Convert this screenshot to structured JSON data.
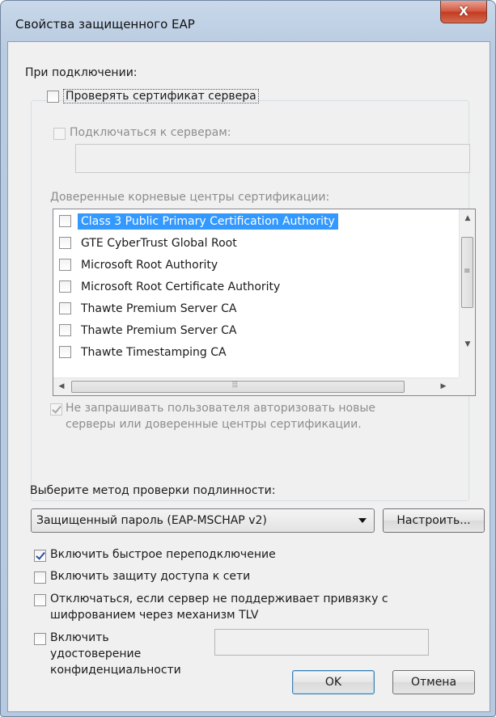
{
  "window": {
    "title": "Свойства защищенного EAP",
    "close_glyph": "X"
  },
  "on_connect": {
    "label": "При подключении:",
    "verify_cert": {
      "label": "Проверять сертификат сервера",
      "checked": false
    },
    "connect_to_servers": {
      "label": "Подключаться к серверам:",
      "checked": false,
      "value": ""
    },
    "trusted_roots_label": "Доверенные корневые центры сертификации:",
    "ca_list": [
      {
        "label": "Class 3 Public Primary Certification Authority",
        "checked": false,
        "selected": true
      },
      {
        "label": "GTE CyberTrust Global Root",
        "checked": false,
        "selected": false
      },
      {
        "label": "Microsoft Root Authority",
        "checked": false,
        "selected": false
      },
      {
        "label": "Microsoft Root Certificate Authority",
        "checked": false,
        "selected": false
      },
      {
        "label": "Thawte Premium Server CA",
        "checked": false,
        "selected": false
      },
      {
        "label": "Thawte Premium Server CA",
        "checked": false,
        "selected": false
      },
      {
        "label": "Thawte Timestamping CA",
        "checked": false,
        "selected": false
      }
    ],
    "no_prompt": {
      "line1": "Не запрашивать пользователя авторизовать новые",
      "line2": "серверы или доверенные центры сертификации.",
      "checked": true
    }
  },
  "auth_method": {
    "label": "Выберите метод проверки подлинности:",
    "selected": "Защищенный пароль (EAP-MSCHAP v2)",
    "configure_button": "Настроить..."
  },
  "options": {
    "fast_reconnect": {
      "label": "Включить быстрое переподключение",
      "checked": true
    },
    "nap": {
      "label": "Включить защиту доступа к сети",
      "checked": false
    },
    "disconnect_tlv": {
      "line1": "Отключаться, если сервер не поддерживает привязку с",
      "line2": "шифрованием через механизм TLV",
      "checked": false
    },
    "identity_privacy": {
      "line1": "Включить",
      "line2": "удостоверение",
      "line3": "конфиденциальности",
      "checked": false,
      "value": ""
    }
  },
  "buttons": {
    "ok": "OK",
    "cancel": "Отмена"
  },
  "colors": {
    "selection": "#3399ff",
    "titlebar": "#b9cbe1",
    "close": "#c23a22"
  }
}
